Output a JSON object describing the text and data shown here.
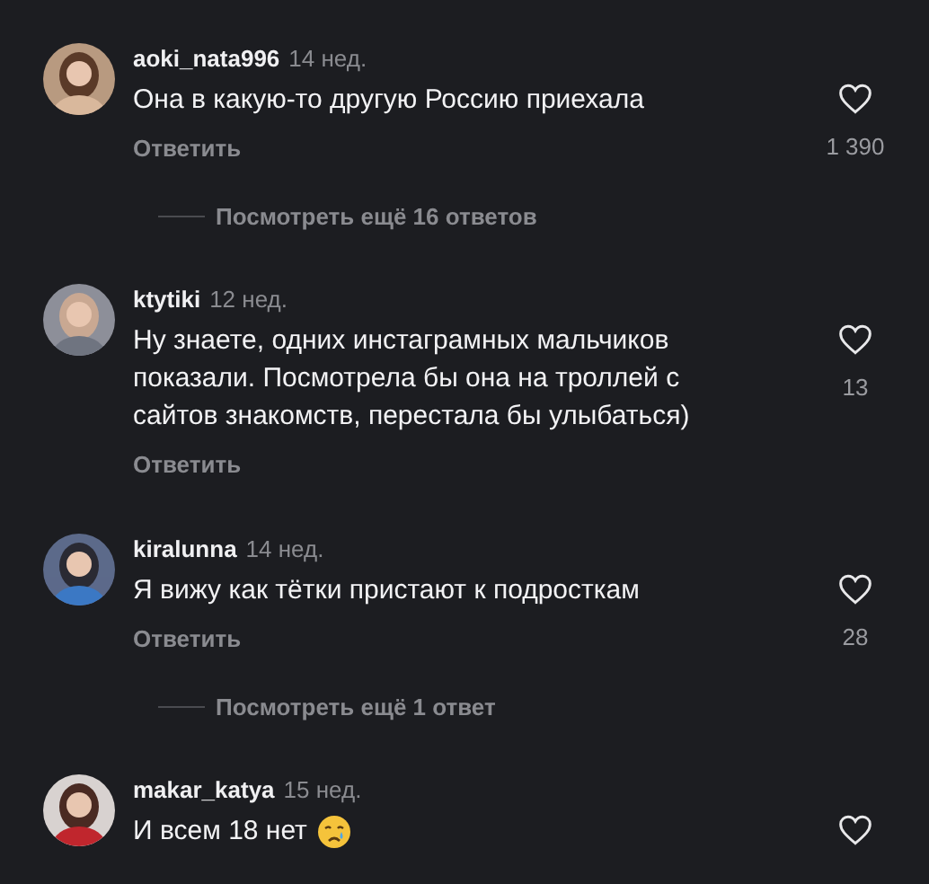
{
  "comments": [
    {
      "username": "aoki_nata996",
      "age": "14 нед.",
      "text": "Она в какую-то другую Россию приехала",
      "reply": "Ответить",
      "likes": "1 390",
      "more_replies": "Посмотреть ещё 16 ответов",
      "emoji": false
    },
    {
      "username": "ktytiki",
      "age": "12 нед.",
      "text": "Ну знаете, одних инстаграмных мальчиков показали. Посмотрела бы она на троллей с сайтов знакомств, перестала бы улыбаться)",
      "reply": "Ответить",
      "likes": "13",
      "emoji": false
    },
    {
      "username": "kiralunna",
      "age": "14 нед.",
      "text": "Я вижу как тётки пристают к подросткам",
      "reply": "Ответить",
      "likes": "28",
      "more_replies": "Посмотреть ещё 1 ответ",
      "emoji": false
    },
    {
      "username": "makar_katya",
      "age": "15 нед.",
      "text": "И всем 18 нет",
      "emoji": true
    }
  ]
}
